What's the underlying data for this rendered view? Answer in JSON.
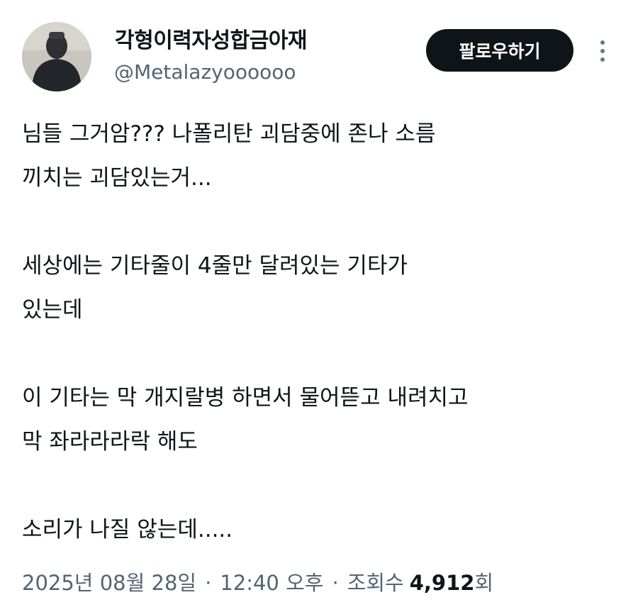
{
  "author": {
    "display_name": "각형이력자성합금아재",
    "handle": "@Metalazyoooooo",
    "avatar_icon": "profile-photo"
  },
  "actions": {
    "follow_label": "팔로우하기",
    "more_icon": "vertical-ellipsis-icon"
  },
  "tweet": {
    "lines": [
      "님들 그거암??? 나폴리탄 괴담중에 존나 소름",
      "끼치는 괴담있는거...",
      "",
      "세상에는 기타줄이 4줄만 달려있는 기타가",
      "있는데",
      "",
      "이 기타는 막 개지랄병 하면서 물어뜯고 내려치고",
      "막 좌라라라락 해도",
      "",
      "소리가 나질 않는데....."
    ]
  },
  "meta": {
    "date": "2025년 08월 28일",
    "separator": "·",
    "time": "12:40 오후",
    "views_label": "조회수",
    "views_count": "4,912",
    "views_suffix": "회"
  },
  "colors": {
    "text": "#0f1419",
    "secondary_text": "#536471",
    "button_bg": "#0f1419",
    "button_text": "#ffffff"
  }
}
